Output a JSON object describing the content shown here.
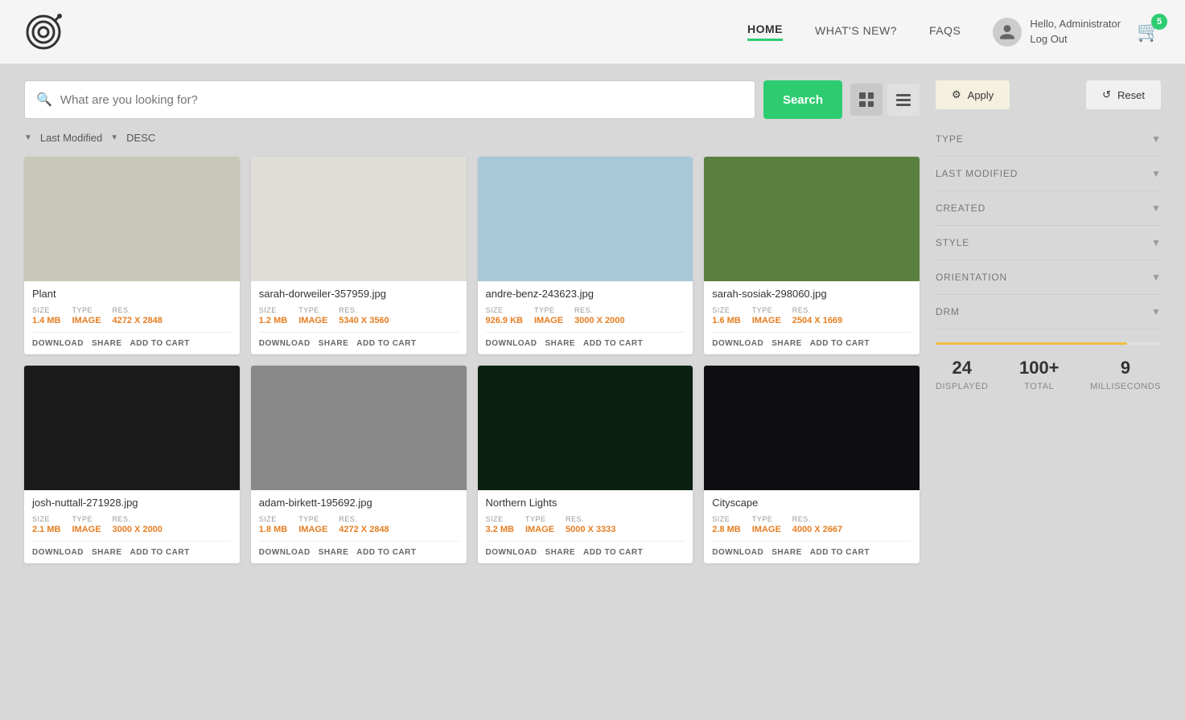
{
  "header": {
    "nav": [
      {
        "label": "HOME",
        "active": true
      },
      {
        "label": "WHAT'S NEW?",
        "active": false
      },
      {
        "label": "FAQS",
        "active": false
      }
    ],
    "user": {
      "greeting": "Hello, Administrator",
      "logout": "Log Out"
    },
    "cart_count": "5"
  },
  "search": {
    "placeholder": "What are you looking for?",
    "button_label": "Search"
  },
  "sort": {
    "field_label": "Last Modified",
    "order_label": "DESC"
  },
  "view_toggle": {
    "grid_label": "Grid View",
    "list_label": "List View"
  },
  "filter": {
    "apply_label": "Apply",
    "reset_label": "Reset",
    "sections": [
      {
        "label": "TYPE"
      },
      {
        "label": "LAST MODIFIED"
      },
      {
        "label": "CREATED"
      },
      {
        "label": "STYLE"
      },
      {
        "label": "ORIENTATION"
      },
      {
        "label": "DRM"
      }
    ]
  },
  "stats": {
    "displayed": "24",
    "displayed_label": "DISPLAYED",
    "total": "100+",
    "total_label": "TOTAL",
    "milliseconds": "9",
    "milliseconds_label": "MILLISECONDS"
  },
  "images": [
    {
      "title": "Plant",
      "size": "1.4 MB",
      "type": "IMAGE",
      "res": "4272 X 2848",
      "bg": "bg-plant",
      "actions": [
        "DOWNLOAD",
        "SHARE",
        "ADD TO CART"
      ]
    },
    {
      "title": "sarah-dorweiler-357959.jpg",
      "size": "1.2 MB",
      "type": "IMAGE",
      "res": "5340 X 3560",
      "bg": "bg-palm",
      "actions": [
        "DOWNLOAD",
        "SHARE",
        "ADD TO CART"
      ]
    },
    {
      "title": "andre-benz-243623.jpg",
      "size": "926.9 KB",
      "type": "IMAGE",
      "res": "3000 X 2000",
      "bg": "bg-building",
      "actions": [
        "DOWNLOAD",
        "SHARE",
        "ADD TO CART"
      ]
    },
    {
      "title": "sarah-sosiak-298060.jpg",
      "size": "1.6 MB",
      "type": "IMAGE",
      "res": "2504 X 1669",
      "bg": "bg-leaf",
      "actions": [
        "DOWNLOAD",
        "SHARE",
        "ADD TO CART"
      ]
    },
    {
      "title": "josh-nuttall-271928.jpg",
      "size": "2.1 MB",
      "type": "IMAGE",
      "res": "3000 X 2000",
      "bg": "bg-bike",
      "actions": [
        "DOWNLOAD",
        "SHARE",
        "ADD TO CART"
      ]
    },
    {
      "title": "adam-birkett-195692.jpg",
      "size": "1.8 MB",
      "type": "IMAGE",
      "res": "4272 X 2848",
      "bg": "bg-stripes",
      "actions": [
        "DOWNLOAD",
        "SHARE",
        "ADD TO CART"
      ]
    },
    {
      "title": "Northern Lights",
      "size": "3.2 MB",
      "type": "IMAGE",
      "res": "5000 X 3333",
      "bg": "bg-aurora",
      "actions": [
        "DOWNLOAD",
        "SHARE",
        "ADD TO CART"
      ]
    },
    {
      "title": "Cityscape",
      "size": "2.8 MB",
      "type": "IMAGE",
      "res": "4000 X 2667",
      "bg": "bg-city",
      "actions": [
        "DOWNLOAD",
        "SHARE",
        "ADD TO CART"
      ]
    }
  ]
}
